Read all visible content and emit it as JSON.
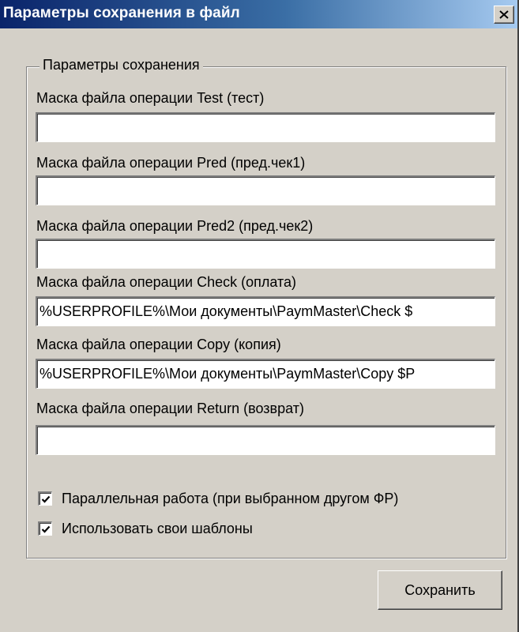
{
  "window": {
    "title": "Параметры сохранения в файл",
    "close_icon": "close-icon"
  },
  "group": {
    "legend": "Параметры сохранения"
  },
  "fields": [
    {
      "label": "Маска файла операции Test (тест)",
      "value": ""
    },
    {
      "label": "Маска файла операции Pred (пред.чек1)",
      "value": ""
    },
    {
      "label": "Маска файла операции Pred2 (пред.чек2)",
      "value": ""
    },
    {
      "label": "Маска файла операции Check (оплата)",
      "value": "%USERPROFILE%\\Мои документы\\PaymMaster\\Check $"
    },
    {
      "label": "Маска файла операции Copy (копия)",
      "value": "%USERPROFILE%\\Мои документы\\PaymMaster\\Copy $P"
    },
    {
      "label": "Маска файла операции Return (возврат)",
      "value": ""
    }
  ],
  "checkboxes": [
    {
      "label": "Параллельная работа (при выбранном другом ФР)",
      "checked": true
    },
    {
      "label": "Использовать свои шаблоны",
      "checked": true
    }
  ],
  "buttons": {
    "save_label": "Сохранить"
  }
}
